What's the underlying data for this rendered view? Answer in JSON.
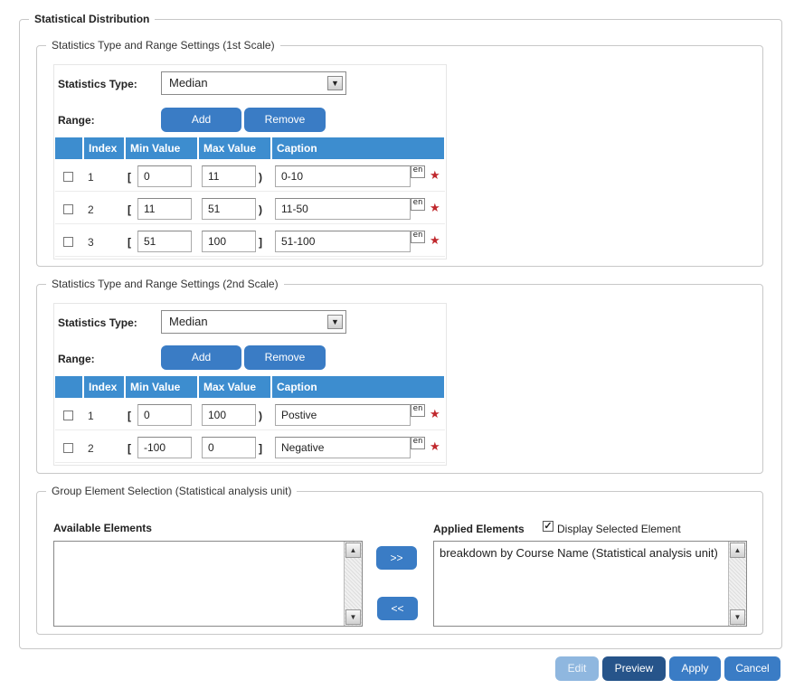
{
  "outer_title": "Statistical Distribution",
  "scale1": {
    "title": "Statistics Type and Range Settings (1st Scale)",
    "stat_label": "Statistics Type:",
    "stat_value": "Median",
    "range_label": "Range:",
    "add": "Add",
    "remove": "Remove",
    "headers": [
      "Index",
      "Min Value",
      "Max Value",
      "Caption"
    ],
    "rows": [
      {
        "index": "1",
        "open": "[",
        "min": "0",
        "max": "11",
        "close": ")",
        "caption": "0-10",
        "lang": "en"
      },
      {
        "index": "2",
        "open": "[",
        "min": "11",
        "max": "51",
        "close": ")",
        "caption": "11-50",
        "lang": "en"
      },
      {
        "index": "3",
        "open": "[",
        "min": "51",
        "max": "100",
        "close": "]",
        "caption": "51-100",
        "lang": "en"
      }
    ]
  },
  "scale2": {
    "title": "Statistics Type and Range Settings (2nd Scale)",
    "stat_label": "Statistics Type:",
    "stat_value": "Median",
    "range_label": "Range:",
    "add": "Add",
    "remove": "Remove",
    "headers": [
      "Index",
      "Min Value",
      "Max Value",
      "Caption"
    ],
    "rows": [
      {
        "index": "1",
        "open": "[",
        "min": "0",
        "max": "100",
        "close": ")",
        "caption": "Postive",
        "lang": "en"
      },
      {
        "index": "2",
        "open": "[",
        "min": "-100",
        "max": "0",
        "close": "]",
        "caption": "Negative",
        "lang": "en"
      }
    ]
  },
  "group": {
    "title": "Group Element Selection (Statistical analysis unit)",
    "available_label": "Available Elements",
    "applied_label": "Applied Elements",
    "display_selected": "Display Selected Element",
    "display_selected_checked": true,
    "move_right": ">>",
    "move_left": "<<",
    "applied_items": [
      "breakdown by Course Name (Statistical analysis unit)"
    ]
  },
  "footer": {
    "edit": "Edit",
    "preview": "Preview",
    "apply": "Apply",
    "cancel": "Cancel"
  },
  "colors": {
    "header_blue": "#3d8dcf",
    "button_blue": "#3a7cc5",
    "button_dark": "#26548a",
    "required_star": "#c0282d"
  }
}
